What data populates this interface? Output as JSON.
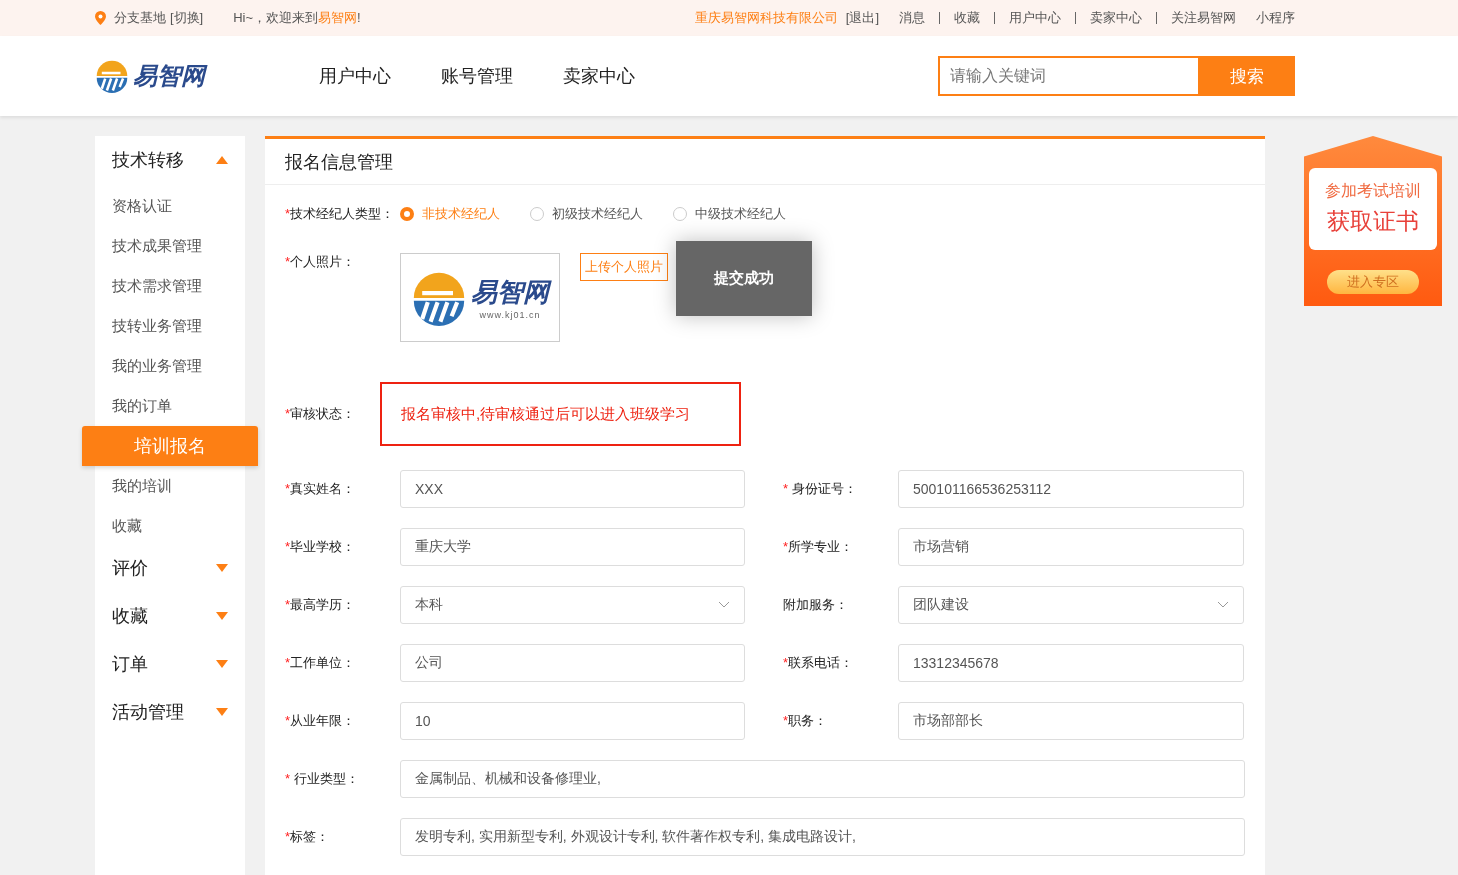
{
  "topbar": {
    "location": "分支基地",
    "switch": "[切换]",
    "greeting": "Hi~，欢迎来到",
    "site": "易智网",
    "exclaim": "!",
    "company": "重庆易智网科技有限公司",
    "logout": "[退出]",
    "links": [
      "消息",
      "收藏",
      "用户中心",
      "卖家中心",
      "关注易智网"
    ],
    "extra": "小程序"
  },
  "header": {
    "logo": "易智网",
    "nav": [
      "用户中心",
      "账号管理",
      "卖家中心"
    ],
    "search": {
      "placeholder": "请输入关键词",
      "button": "搜索"
    }
  },
  "sidebar": [
    {
      "title": "技术转移",
      "expanded": true,
      "children": [
        {
          "label": "资格认证",
          "selected": false
        },
        {
          "label": "技术成果管理",
          "selected": false
        },
        {
          "label": "技术需求管理",
          "selected": false
        },
        {
          "label": "技转业务管理",
          "selected": false
        },
        {
          "label": "我的业务管理",
          "selected": false
        },
        {
          "label": "我的订单",
          "selected": false
        },
        {
          "label": "培训报名",
          "selected": true
        },
        {
          "label": "我的培训",
          "selected": false
        },
        {
          "label": "收藏",
          "selected": false
        }
      ]
    },
    {
      "title": "评价",
      "expanded": false
    },
    {
      "title": "收藏",
      "expanded": false
    },
    {
      "title": "订单",
      "expanded": false
    },
    {
      "title": "活动管理",
      "expanded": false
    }
  ],
  "panel": {
    "title": "报名信息管理",
    "broker": {
      "star": "*",
      "label": "技术经纪人类型：",
      "options": [
        {
          "label": "非技术经纪人",
          "selected": true
        },
        {
          "label": "初级技术经纪人",
          "selected": false
        },
        {
          "label": "中级技术经纪人",
          "selected": false
        }
      ]
    },
    "photo": {
      "star": "*",
      "label": "个人照片：",
      "logo": "易智网",
      "url": "www.kj01.cn",
      "upload": "上传个人照片"
    },
    "toast": "提交成功",
    "status": {
      "star": "*",
      "label": "审核状态：",
      "text": "报名审核中,待审核通过后可以进入班级学习"
    },
    "rows": [
      [
        {
          "star": "*",
          "label": "真实姓名：",
          "kind": "text",
          "value": "XXX"
        },
        {
          "star": "* ",
          "label": "身份证号：",
          "kind": "text",
          "value": "500101166536253112"
        }
      ],
      [
        {
          "star": "*",
          "label": "毕业学校：",
          "kind": "text",
          "value": "重庆大学"
        },
        {
          "star": "*",
          "label": "所学专业：",
          "kind": "text",
          "value": "市场营销"
        }
      ],
      [
        {
          "star": "*",
          "label": "最高学历：",
          "kind": "select",
          "value": "本科"
        },
        {
          "label": "附加服务：",
          "kind": "select",
          "value": "团队建设"
        }
      ],
      [
        {
          "star": "*",
          "label": "工作单位：",
          "kind": "text",
          "value": "公司"
        },
        {
          "star": "*",
          "label": "联系电话：",
          "kind": "text",
          "value": "13312345678"
        }
      ],
      [
        {
          "star": "*",
          "label": "从业年限：",
          "kind": "text",
          "value": "10"
        },
        {
          "star": "*",
          "label": "职务：",
          "kind": "text",
          "value": "市场部部长"
        }
      ],
      [
        {
          "star": "* ",
          "label": "行业类型：",
          "kind": "text",
          "value": "金属制品、机械和设备修理业,"
        }
      ],
      [
        {
          "star": "*",
          "label": "标签：",
          "kind": "text",
          "value": "发明专利, 实用新型专利, 外观设计专利, 软件著作权专利, 集成电路设计,"
        }
      ]
    ]
  },
  "banner": {
    "line1": "参加考试培训",
    "line2": "获取证书",
    "button": "进入专区"
  }
}
